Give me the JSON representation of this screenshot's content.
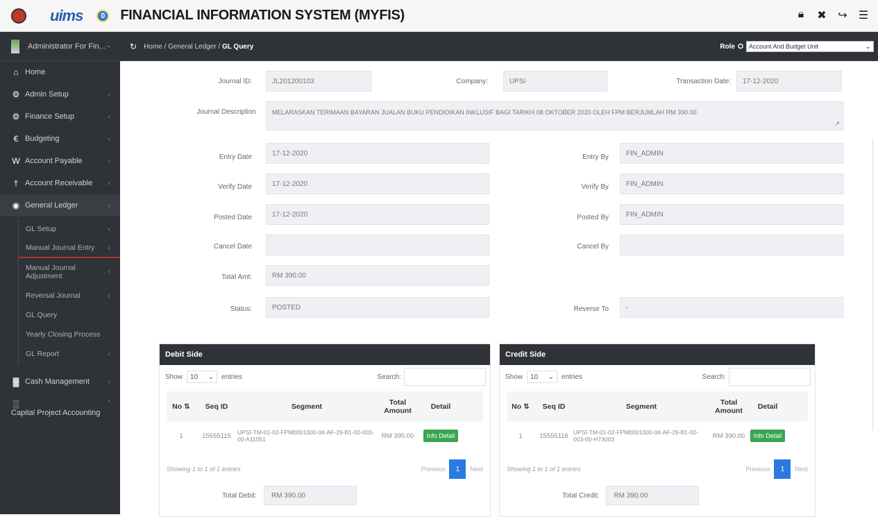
{
  "header": {
    "logo_text": "uims",
    "badge_number": "0",
    "title": "FINANCIAL INFORMATION SYSTEM (MYFIS)",
    "icons": [
      "lock-icon",
      "expand-icon",
      "logout-icon",
      "menu-icon"
    ]
  },
  "sidebar": {
    "user": "Administrator For Fin... -",
    "items": [
      {
        "label": "Home",
        "icon": "home-icon"
      },
      {
        "label": "Admin Setup",
        "icon": "gears-icon"
      },
      {
        "label": "Finance Setup",
        "icon": "gear-icon"
      },
      {
        "label": "Budgeting",
        "icon": "euro-icon"
      },
      {
        "label": "Account Payable",
        "icon": "w-icon"
      },
      {
        "label": "Account Receivable",
        "icon": "pin-icon"
      },
      {
        "label": "General Ledger",
        "icon": "globe-icon"
      }
    ],
    "sub_items": [
      {
        "label": "GL Setup"
      },
      {
        "label": "Manual Journal Entry"
      },
      {
        "label": "Manual Journal Adjustment"
      },
      {
        "label": "Reversal Journal"
      },
      {
        "label": "GL Query"
      },
      {
        "label": "Yearly Closing Process"
      },
      {
        "label": "GL Report"
      }
    ],
    "bottom_items": [
      {
        "label": "Cash Management",
        "icon": "bank-icon"
      },
      {
        "label": "Capital Project Accounting",
        "icon": "building-icon"
      }
    ]
  },
  "breadcrumb": {
    "home": "Home",
    "sep": "/",
    "section": "General Ledger",
    "current": "GL Query",
    "role_label": "Role",
    "role_value": "Account And Budget Unit"
  },
  "form": {
    "journal_id_label": "Journal ID:",
    "journal_id": "JL201200103",
    "company_label": "Company:",
    "company": "UPSI",
    "transaction_date_label": "Transaction Date:",
    "transaction_date": "17-12-2020",
    "description_label": "Journal Description",
    "description": "MELARASKAN TERIMAAN BAYARAN JUALAN BUKU PENDIDIKAN INKLUSIF BAGI TARIKH 08 OKTOBER 2020 OLEH FPM BERJUMLAH RM 390.00",
    "entry_date_label": "Entry Date",
    "entry_date": "17-12-2020",
    "entry_by_label": "Entry By",
    "entry_by": "FIN_ADMIN",
    "verify_date_label": "Verify Date",
    "verify_date": "17-12-2020",
    "verify_by_label": "Verify By",
    "verify_by": "FIN_ADMIN",
    "posted_date_label": "Posted Date",
    "posted_date": "17-12-2020",
    "posted_by_label": "Posted By",
    "posted_by": "FIN_ADMIN",
    "cancel_date_label": "Cancel Date",
    "cancel_date": "",
    "cancel_by_label": "Cancel By",
    "cancel_by": "",
    "total_amt_label": "Total Amt:",
    "total_amt": "RM 390.00",
    "status_label": "Status:",
    "status": "POSTED",
    "reverse_to_label": "Reverse To",
    "reverse_to": "-"
  },
  "debit": {
    "title": "Debit Side",
    "show": "Show",
    "page_size": "10",
    "entries": "entries",
    "search": "Search:",
    "columns": [
      "No",
      "Seq ID",
      "Segment",
      "Total Amount",
      "Detail"
    ],
    "rows": [
      {
        "no": "1",
        "seq": "15555115",
        "segment": "UPSI-TM-01-02-FPM0001000-04-AF-29-B1-00-003-00-A11051",
        "amount": "RM 390.00",
        "detail": "Info Detail"
      }
    ],
    "showing": "Showing 1 to 1 of 1 entries",
    "previous": "Previous",
    "page": "1",
    "next": "Next",
    "total_label": "Total Debit:",
    "total": "RM 390.00"
  },
  "credit": {
    "title": "Credit Side",
    "show": "Show",
    "page_size": "10",
    "entries": "entries",
    "search": "Search:",
    "columns": [
      "No",
      "Seq ID",
      "Segment",
      "Total Amount",
      "Detail"
    ],
    "rows": [
      {
        "no": "1",
        "seq": "15555116",
        "segment": "UPSI-TM-01-02-FPM0001000-04-AF-29-B1-00-003-00-H73003",
        "amount": "RM 390.00",
        "detail": "Info Detail"
      }
    ],
    "showing": "Showing 1 to 1 of 1 entries",
    "previous": "Previous",
    "page": "1",
    "next": "Next",
    "total_label": "Total Credit:",
    "total": "RM 390.00"
  }
}
